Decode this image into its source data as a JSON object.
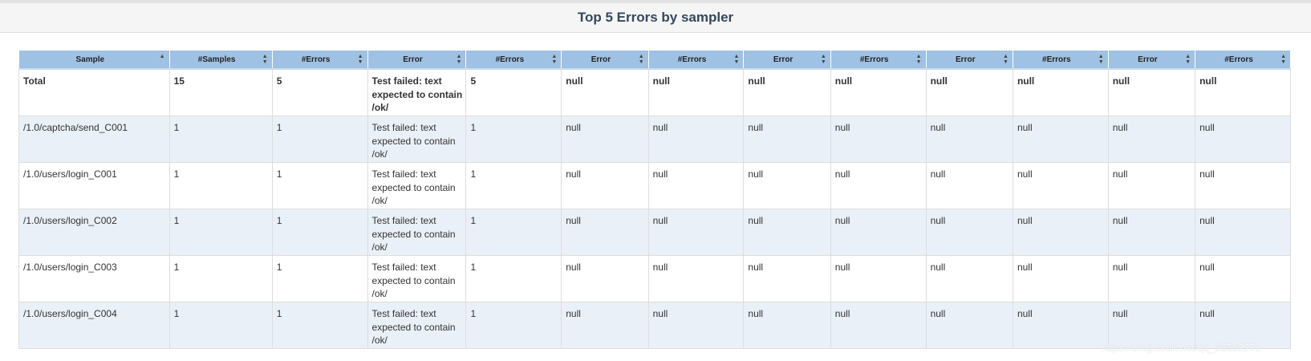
{
  "title": "Top 5 Errors by sampler",
  "columns": [
    "Sample",
    "#Samples",
    "#Errors",
    "Error",
    "#Errors",
    "Error",
    "#Errors",
    "Error",
    "#Errors",
    "Error",
    "#Errors",
    "Error",
    "#Errors"
  ],
  "sort": {
    "active_column": 0,
    "direction": "ascending"
  },
  "rows": [
    {
      "kind": "total",
      "cells": [
        "Total",
        "15",
        "5",
        "Test failed: text expected to contain /ok/",
        "5",
        "null",
        "null",
        "null",
        "null",
        "null",
        "null",
        "null",
        "null"
      ]
    },
    {
      "kind": "odd",
      "cells": [
        "/1.0/captcha/send_C001",
        "1",
        "1",
        "Test failed: text expected to contain /ok/",
        "1",
        "null",
        "null",
        "null",
        "null",
        "null",
        "null",
        "null",
        "null"
      ]
    },
    {
      "kind": "even",
      "cells": [
        "/1.0/users/login_C001",
        "1",
        "1",
        "Test failed: text expected to contain /ok/",
        "1",
        "null",
        "null",
        "null",
        "null",
        "null",
        "null",
        "null",
        "null"
      ]
    },
    {
      "kind": "odd",
      "cells": [
        "/1.0/users/login_C002",
        "1",
        "1",
        "Test failed: text expected to contain /ok/",
        "1",
        "null",
        "null",
        "null",
        "null",
        "null",
        "null",
        "null",
        "null"
      ]
    },
    {
      "kind": "even",
      "cells": [
        "/1.0/users/login_C003",
        "1",
        "1",
        "Test failed: text expected to contain /ok/",
        "1",
        "null",
        "null",
        "null",
        "null",
        "null",
        "null",
        "null",
        "null"
      ]
    },
    {
      "kind": "odd",
      "cells": [
        "/1.0/users/login_C004",
        "1",
        "1",
        "Test failed: text expected to contain /ok/",
        "1",
        "null",
        "null",
        "null",
        "null",
        "null",
        "null",
        "null",
        "null"
      ]
    }
  ],
  "watermark": "https://blog.csdn.net/qq_36502272",
  "colors": {
    "header_bg": "#9fc1e3",
    "odd_row_bg": "#e9f0f8",
    "title_color": "#34495e"
  }
}
